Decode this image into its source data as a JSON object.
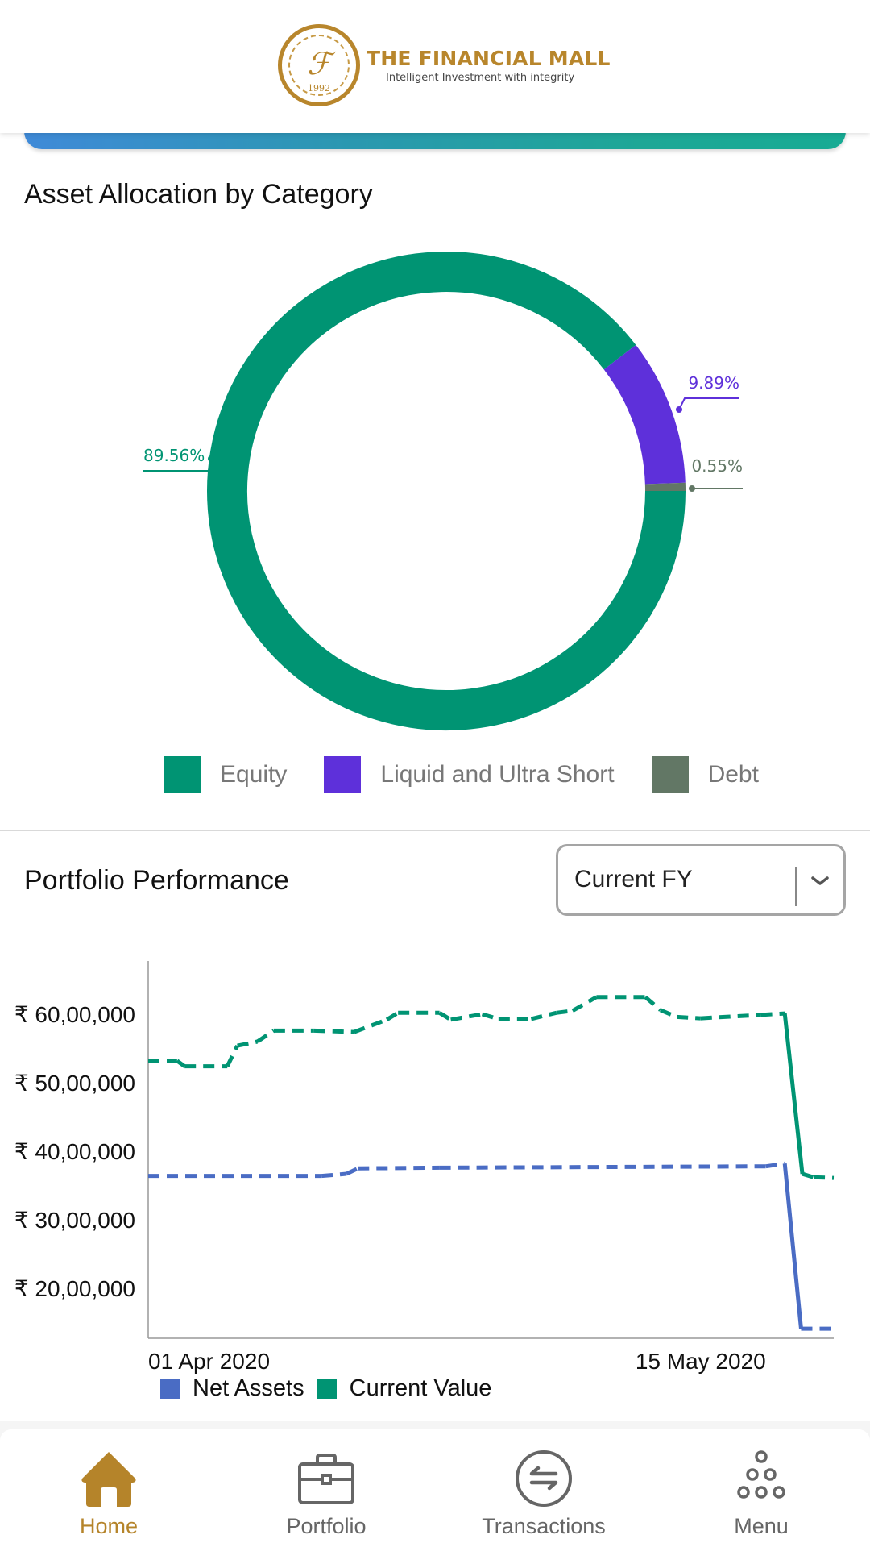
{
  "header": {
    "brand_name": "THE FINANCIAL MALL",
    "tagline": "Intelligent Investment with integrity",
    "seal_monogram": "ℱ",
    "seal_year": "1992",
    "brand_color": "#b8862c"
  },
  "allocation": {
    "title": "Asset Allocation by Category",
    "legend": [
      {
        "label": "Equity",
        "color": "#009473"
      },
      {
        "label": "Liquid and Ultra Short",
        "color": "#5e30da"
      },
      {
        "label": "Debt",
        "color": "#627765"
      }
    ]
  },
  "performance": {
    "title": "Portfolio Performance",
    "period_select": {
      "value": "Current FY",
      "icon": "chevron-down-icon"
    },
    "legend": [
      {
        "label": "Net Assets",
        "color": "#4a6cc4"
      },
      {
        "label": "Current Value",
        "color": "#009473"
      }
    ]
  },
  "chart_data": [
    {
      "type": "pie",
      "variant": "donut",
      "title": "Asset Allocation by Category",
      "slices": [
        {
          "label": "Equity",
          "value": 89.56,
          "display": "89.56%",
          "color": "#009473"
        },
        {
          "label": "Liquid and Ultra Short",
          "value": 9.89,
          "display": "9.89%",
          "color": "#5e30da"
        },
        {
          "label": "Debt",
          "value": 0.55,
          "display": "0.55%",
          "color": "#627765"
        }
      ],
      "legend_position": "bottom"
    },
    {
      "type": "line",
      "title": "Portfolio Performance",
      "x_unit": "days since 01 Apr 2020",
      "x_ticks": [
        {
          "x": 0,
          "label": "01 Apr 2020"
        },
        {
          "x": 44,
          "label": "15 May 2020"
        }
      ],
      "xlim": [
        0,
        54.6
      ],
      "y_unit": "lakh INR",
      "y_ticks": [
        {
          "y": 20,
          "label": "₹ 20,00,000"
        },
        {
          "y": 30,
          "label": "₹ 30,00,000"
        },
        {
          "y": 40,
          "label": "₹ 40,00,000"
        },
        {
          "y": 50,
          "label": "₹ 50,00,000"
        },
        {
          "y": 60,
          "label": "₹ 60,00,000"
        }
      ],
      "ylim": [
        12.4,
        67
      ],
      "grid": false,
      "legend_position": "bottom-left",
      "series": [
        {
          "name": "Net Assets",
          "color": "#4a6cc4",
          "x": [
            0,
            13.8,
            15.8,
            16.7,
            23.2,
            49.2,
            50.7,
            52.0,
            54.6
          ],
          "y": [
            36.4,
            36.4,
            36.7,
            37.5,
            37.6,
            37.8,
            38.2,
            14.1,
            14.1
          ]
        },
        {
          "name": "Current Value",
          "color": "#009473",
          "x": [
            0,
            2.3,
            2.9,
            6.3,
            7.1,
            8.7,
            10.0,
            13.2,
            16.4,
            19.0,
            19.9,
            23.2,
            24.1,
            26.6,
            27.9,
            30.5,
            32.5,
            33.8,
            35.7,
            39.6,
            40.8,
            42.1,
            44.0,
            48.8,
            50.7,
            52.1,
            53.0,
            54.6
          ],
          "y": [
            53.2,
            53.2,
            52.4,
            52.4,
            55.4,
            56.0,
            57.6,
            57.6,
            57.4,
            59.2,
            60.2,
            60.2,
            59.2,
            60.0,
            59.3,
            59.3,
            60.2,
            60.5,
            62.5,
            62.5,
            60.6,
            59.6,
            59.4,
            59.9,
            60.1,
            36.7,
            36.2,
            36.1
          ]
        }
      ]
    }
  ],
  "tabbar": {
    "items": [
      {
        "label": "Home",
        "icon": "home-icon",
        "active": true
      },
      {
        "label": "Portfolio",
        "icon": "briefcase-icon",
        "active": false
      },
      {
        "label": "Transactions",
        "icon": "transfer-icon",
        "active": false
      },
      {
        "label": "Menu",
        "icon": "menu-dots-icon",
        "active": false
      }
    ],
    "active_color": "#b5842a",
    "inactive_color": "#666666"
  }
}
